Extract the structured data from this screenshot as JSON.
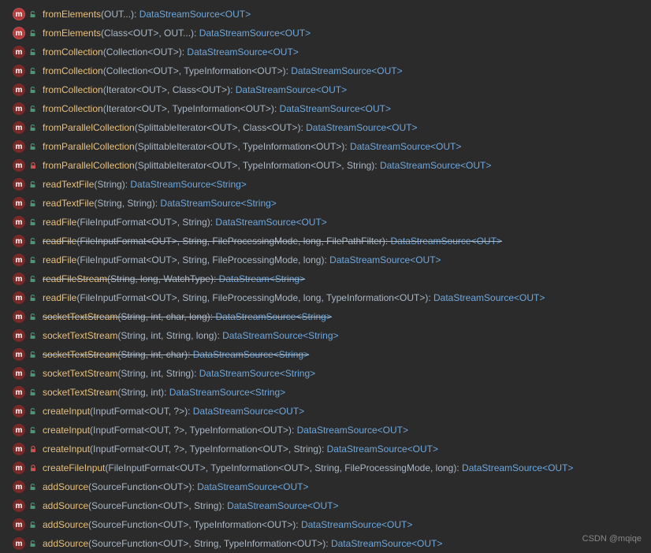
{
  "watermark": "CSDN @mqiqe",
  "icon_text": "m",
  "methods": [
    {
      "iconStyle": "bright",
      "lock": "green",
      "name": "fromElements",
      "params": "(OUT...)",
      "return": "DataStreamSource<OUT>",
      "deprecated": false
    },
    {
      "iconStyle": "bright",
      "lock": "green",
      "name": "fromElements",
      "params": "(Class<OUT>, OUT...)",
      "return": "DataStreamSource<OUT>",
      "deprecated": false
    },
    {
      "iconStyle": "dark",
      "lock": "green",
      "name": "fromCollection",
      "params": "(Collection<OUT>)",
      "return": "DataStreamSource<OUT>",
      "deprecated": false
    },
    {
      "iconStyle": "dark",
      "lock": "green",
      "name": "fromCollection",
      "params": "(Collection<OUT>, TypeInformation<OUT>)",
      "return": "DataStreamSource<OUT>",
      "deprecated": false
    },
    {
      "iconStyle": "dark",
      "lock": "green",
      "name": "fromCollection",
      "params": "(Iterator<OUT>, Class<OUT>)",
      "return": "DataStreamSource<OUT>",
      "deprecated": false
    },
    {
      "iconStyle": "dark",
      "lock": "green",
      "name": "fromCollection",
      "params": "(Iterator<OUT>, TypeInformation<OUT>)",
      "return": "DataStreamSource<OUT>",
      "deprecated": false
    },
    {
      "iconStyle": "dark",
      "lock": "green",
      "name": "fromParallelCollection",
      "params": "(SplittableIterator<OUT>, Class<OUT>)",
      "return": "DataStreamSource<OUT>",
      "deprecated": false
    },
    {
      "iconStyle": "dark",
      "lock": "green",
      "name": "fromParallelCollection",
      "params": "(SplittableIterator<OUT>, TypeInformation<OUT>)",
      "return": "DataStreamSource<OUT>",
      "deprecated": false
    },
    {
      "iconStyle": "dark",
      "lock": "red",
      "name": "fromParallelCollection",
      "params": "(SplittableIterator<OUT>, TypeInformation<OUT>, String)",
      "return": "DataStreamSource<OUT>",
      "deprecated": false
    },
    {
      "iconStyle": "dark",
      "lock": "green",
      "name": "readTextFile",
      "params": "(String)",
      "return": "DataStreamSource<String>",
      "deprecated": false
    },
    {
      "iconStyle": "dark",
      "lock": "green",
      "name": "readTextFile",
      "params": "(String, String)",
      "return": "DataStreamSource<String>",
      "deprecated": false
    },
    {
      "iconStyle": "dark",
      "lock": "green",
      "name": "readFile",
      "params": "(FileInputFormat<OUT>, String)",
      "return": "DataStreamSource<OUT>",
      "deprecated": false
    },
    {
      "iconStyle": "dark",
      "lock": "green",
      "name": "readFile",
      "params": "(FileInputFormat<OUT>, String, FileProcessingMode, long, FilePathFilter)",
      "return": "DataStreamSource<OUT>",
      "deprecated": true
    },
    {
      "iconStyle": "dark",
      "lock": "green",
      "name": "readFile",
      "params": "(FileInputFormat<OUT>, String, FileProcessingMode, long)",
      "return": "DataStreamSource<OUT>",
      "deprecated": false
    },
    {
      "iconStyle": "dark",
      "lock": "green",
      "name": "readFileStream",
      "params": "(String, long, WatchType)",
      "return": "DataStream<String>",
      "deprecated": true
    },
    {
      "iconStyle": "dark",
      "lock": "green",
      "name": "readFile",
      "params": "(FileInputFormat<OUT>, String, FileProcessingMode, long, TypeInformation<OUT>)",
      "return": "DataStreamSource<OUT>",
      "deprecated": false
    },
    {
      "iconStyle": "dark",
      "lock": "green",
      "name": "socketTextStream",
      "params": "(String, int, char, long)",
      "return": "DataStreamSource<String>",
      "deprecated": true
    },
    {
      "iconStyle": "dark",
      "lock": "green",
      "name": "socketTextStream",
      "params": "(String, int, String, long)",
      "return": "DataStreamSource<String>",
      "deprecated": false
    },
    {
      "iconStyle": "dark",
      "lock": "green",
      "name": "socketTextStream",
      "params": "(String, int, char)",
      "return": "DataStreamSource<String>",
      "deprecated": true
    },
    {
      "iconStyle": "dark",
      "lock": "green",
      "name": "socketTextStream",
      "params": "(String, int, String)",
      "return": "DataStreamSource<String>",
      "deprecated": false
    },
    {
      "iconStyle": "dark",
      "lock": "green",
      "name": "socketTextStream",
      "params": "(String, int)",
      "return": "DataStreamSource<String>",
      "deprecated": false
    },
    {
      "iconStyle": "dark",
      "lock": "green",
      "name": "createInput",
      "params": "(InputFormat<OUT, ?>)",
      "return": "DataStreamSource<OUT>",
      "deprecated": false
    },
    {
      "iconStyle": "dark",
      "lock": "green",
      "name": "createInput",
      "params": "(InputFormat<OUT, ?>, TypeInformation<OUT>)",
      "return": "DataStreamSource<OUT>",
      "deprecated": false
    },
    {
      "iconStyle": "dark",
      "lock": "red",
      "name": "createInput",
      "params": "(InputFormat<OUT, ?>, TypeInformation<OUT>, String)",
      "return": "DataStreamSource<OUT>",
      "deprecated": false
    },
    {
      "iconStyle": "dark",
      "lock": "red",
      "name": "createFileInput",
      "params": "(FileInputFormat<OUT>, TypeInformation<OUT>, String, FileProcessingMode, long)",
      "return": "DataStreamSource<OUT>",
      "deprecated": false
    },
    {
      "iconStyle": "dark",
      "lock": "green",
      "name": "addSource",
      "params": "(SourceFunction<OUT>)",
      "return": "DataStreamSource<OUT>",
      "deprecated": false
    },
    {
      "iconStyle": "dark",
      "lock": "green",
      "name": "addSource",
      "params": "(SourceFunction<OUT>, String)",
      "return": "DataStreamSource<OUT>",
      "deprecated": false
    },
    {
      "iconStyle": "dark",
      "lock": "green",
      "name": "addSource",
      "params": "(SourceFunction<OUT>, TypeInformation<OUT>)",
      "return": "DataStreamSource<OUT>",
      "deprecated": false
    },
    {
      "iconStyle": "dark",
      "lock": "green",
      "name": "addSource",
      "params": "(SourceFunction<OUT>, String, TypeInformation<OUT>)",
      "return": "DataStreamSource<OUT>",
      "deprecated": false
    }
  ]
}
